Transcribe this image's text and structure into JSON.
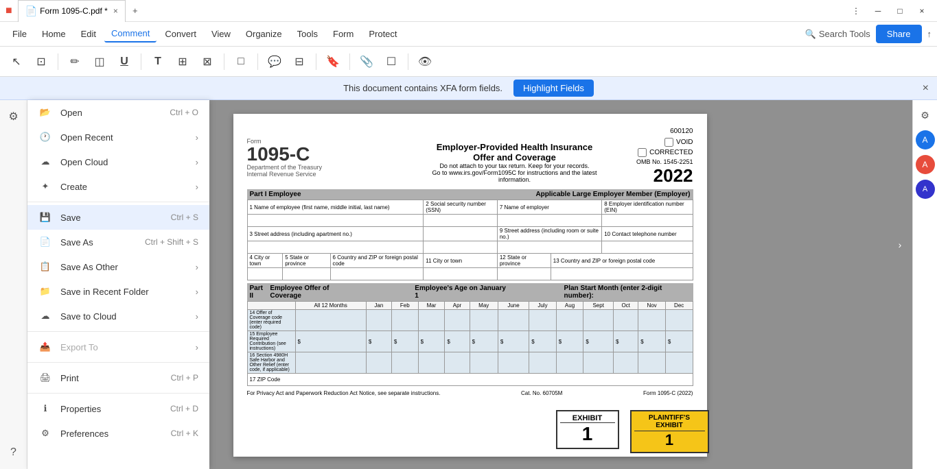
{
  "window": {
    "title": "Form 1095-C.pdf *",
    "tab_label": "Form 1095-C.pdf *"
  },
  "title_bar": {
    "app_icon": "■",
    "tab_close": "×",
    "new_tab": "+",
    "minimize": "─",
    "maximize": "□",
    "close": "×"
  },
  "menu_bar": {
    "items": [
      {
        "id": "file",
        "label": "File"
      },
      {
        "id": "home",
        "label": "Home"
      },
      {
        "id": "edit",
        "label": "Edit"
      },
      {
        "id": "comment",
        "label": "Comment",
        "active": true
      },
      {
        "id": "convert",
        "label": "Convert"
      },
      {
        "id": "view",
        "label": "View"
      },
      {
        "id": "organize",
        "label": "Organize"
      },
      {
        "id": "tools",
        "label": "Tools"
      },
      {
        "id": "form",
        "label": "Form"
      },
      {
        "id": "protect",
        "label": "Protect"
      }
    ],
    "search_tools_label": "Search Tools",
    "share_label": "Share",
    "upload_icon": "↑"
  },
  "toolbar": {
    "tools": [
      {
        "id": "cursor",
        "icon": "↖",
        "label": "cursor"
      },
      {
        "id": "select",
        "icon": "⊡",
        "label": "select"
      },
      {
        "id": "pen",
        "icon": "✏",
        "label": "pen"
      },
      {
        "id": "eraser",
        "icon": "◫",
        "label": "eraser"
      },
      {
        "id": "underline",
        "icon": "U̲",
        "label": "underline"
      },
      {
        "id": "text",
        "icon": "T",
        "label": "text"
      },
      {
        "id": "textbox",
        "icon": "⊞",
        "label": "textbox"
      },
      {
        "id": "callout",
        "icon": "⊠",
        "label": "callout"
      },
      {
        "id": "shapes",
        "icon": "□",
        "label": "shapes"
      },
      {
        "id": "comment",
        "icon": "💬",
        "label": "comment"
      },
      {
        "id": "measure",
        "icon": "⊟",
        "label": "measure"
      },
      {
        "id": "stamp",
        "icon": "🔖",
        "label": "stamp"
      },
      {
        "id": "attach",
        "icon": "📎",
        "label": "attach"
      },
      {
        "id": "note",
        "icon": "☐",
        "label": "note"
      },
      {
        "id": "eye",
        "icon": "👁",
        "label": "eye"
      }
    ]
  },
  "notification": {
    "text": "This document contains XFA form fields.",
    "button_label": "Highlight Fields",
    "close_icon": "×"
  },
  "file_menu": {
    "items": [
      {
        "id": "open",
        "icon": "📂",
        "label": "Open",
        "shortcut": "Ctrl + O",
        "has_arrow": false
      },
      {
        "id": "open-recent",
        "icon": "🕐",
        "label": "Open Recent",
        "shortcut": "",
        "has_arrow": true
      },
      {
        "id": "open-cloud",
        "icon": "☁",
        "label": "Open Cloud",
        "shortcut": "",
        "has_arrow": true
      },
      {
        "id": "create",
        "icon": "✦",
        "label": "Create",
        "shortcut": "",
        "has_arrow": true
      },
      {
        "id": "separator1"
      },
      {
        "id": "save",
        "icon": "💾",
        "label": "Save",
        "shortcut": "Ctrl + S",
        "has_arrow": false,
        "active": true
      },
      {
        "id": "save-as",
        "icon": "📄",
        "label": "Save As",
        "shortcut": "Ctrl + Shift + S",
        "has_arrow": false
      },
      {
        "id": "save-as-other",
        "icon": "📋",
        "label": "Save As Other",
        "shortcut": "",
        "has_arrow": true
      },
      {
        "id": "save-in-recent",
        "icon": "📁",
        "label": "Save in Recent Folder",
        "shortcut": "",
        "has_arrow": true
      },
      {
        "id": "save-to-cloud",
        "icon": "☁",
        "label": "Save to Cloud",
        "shortcut": "",
        "has_arrow": true
      },
      {
        "id": "separator2"
      },
      {
        "id": "export-to",
        "icon": "📤",
        "label": "Export To",
        "shortcut": "",
        "has_arrow": true,
        "disabled": true
      },
      {
        "id": "separator3"
      },
      {
        "id": "print",
        "icon": "🖨",
        "label": "Print",
        "shortcut": "Ctrl + P",
        "has_arrow": false
      },
      {
        "id": "separator4"
      },
      {
        "id": "properties",
        "icon": "ℹ",
        "label": "Properties",
        "shortcut": "Ctrl + D",
        "has_arrow": false
      },
      {
        "id": "preferences",
        "icon": "⚙",
        "label": "Preferences",
        "shortcut": "Ctrl + K",
        "has_arrow": false
      }
    ]
  },
  "pdf": {
    "id_top": "600120",
    "form_number": "1095-C",
    "dept": "Department of the Treasury",
    "irs": "Internal Revenue Service",
    "title": "Employer-Provided Health Insurance Offer and Coverage",
    "subtitle1": "Do not attach to your tax return. Keep for your records.",
    "subtitle2": "Go to www.irs.gov/Form1095C for instructions and the latest information.",
    "void_label": "VOID",
    "corrected_label": "CORRECTED",
    "omb_label": "OMB No. 1545-2251",
    "year": "2022",
    "part1_label": "Part I",
    "part1_title": "Employee",
    "part1_right": "Applicable Large Employer Member (Employer)",
    "part2_label": "Part II",
    "part2_title": "Employee Offer of Coverage",
    "employees_age": "Employee's Age on January 1",
    "plan_start": "Plan Start Month (enter 2-digit number):",
    "months": [
      "All 12 Months",
      "Jan",
      "Feb",
      "Mar",
      "Apr",
      "May",
      "June",
      "July",
      "Aug",
      "Sept",
      "Oct",
      "Nov",
      "Dec"
    ],
    "months_right": [
      "All 12 Months",
      "Jan",
      "Feb",
      "Mar",
      "Apr",
      "May"
    ],
    "row14": "14 Offer of Coverage code (enter required code)",
    "row15": "15 Employee Required Contribution (see instructions)",
    "row15_vals": [
      "$",
      "$",
      "$",
      "$",
      "$",
      "$",
      "$",
      "$",
      "$",
      "$",
      "$",
      "$",
      "$"
    ],
    "row16": "16 Section 4980H Safe Harbor and Other Relief (enter code, if applicable)",
    "row17": "17 ZIP Code",
    "footer1": "For Privacy Act and Paperwork Reduction Act Notice, see separate instructions.",
    "cat_no": "Cat. No. 60705M",
    "form_footer": "Form 1095-C (2022)",
    "exhibit1_title": "EXHIBIT",
    "exhibit1_num": "1",
    "exhibit2_title": "PLAINTIFF'S",
    "exhibit2_sub": "EXHIBIT",
    "exhibit2_num": "1"
  },
  "right_panel": {
    "icons": [
      "🔽",
      "🤖",
      "A"
    ]
  },
  "sidebar": {
    "icons": [
      "?"
    ]
  }
}
